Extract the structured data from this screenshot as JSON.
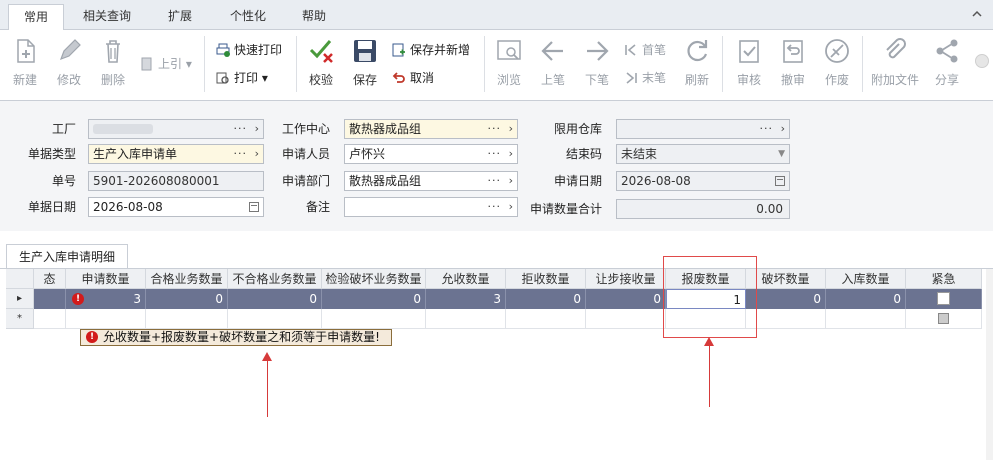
{
  "menu": {
    "tabs": [
      {
        "label": "常用",
        "active": true
      },
      {
        "label": "相关查询"
      },
      {
        "label": "扩展"
      },
      {
        "label": "个性化"
      },
      {
        "label": "帮助"
      }
    ]
  },
  "ribbon": {
    "new": "新建",
    "modify": "修改",
    "delete": "删除",
    "quote": "上引",
    "quick_print": "快速打印",
    "print": "打印",
    "verify": "校验",
    "save": "保存",
    "save_new": "保存并新增",
    "cancel": "取消",
    "browse": "浏览",
    "prev": "上笔",
    "next": "下笔",
    "first": "首笔",
    "last": "末笔",
    "refresh": "刷新",
    "audit": "审核",
    "unaudit": "撤审",
    "void": "作废",
    "attach": "附加文件",
    "share": "分享"
  },
  "form": {
    "factory_label": "工厂",
    "doc_type_label": "单据类型",
    "doc_type_value": "生产入库申请单",
    "doc_no_label": "单号",
    "doc_no_value": "5901-202608080001",
    "doc_date_label": "单据日期",
    "doc_date_value": "2026-08-08",
    "work_center_label": "工作中心",
    "work_center_value": "散热器成品组",
    "applicant_label": "申请人员",
    "applicant_value": "卢怀兴",
    "apply_dept_label": "申请部门",
    "apply_dept_value": "散热器成品组",
    "remark_label": "备注",
    "remark_value": "",
    "limit_wh_label": "限用仓库",
    "limit_wh_value": "",
    "close_code_label": "结束码",
    "close_code_value": "未结束",
    "apply_date_label": "申请日期",
    "apply_date_value": "2026-08-08",
    "apply_total_label": "申请数量合计",
    "apply_total_value": "0.00"
  },
  "detail": {
    "tab_label": "生产入库申请明细",
    "columns": [
      "态",
      "申请数量",
      "合格业务数量",
      "不合格业务数量",
      "检验破坏业务数量",
      "允收数量",
      "拒收数量",
      "让步接收量",
      "报废数量",
      "破坏数量",
      "入库数量",
      "紧急"
    ],
    "row1": [
      "",
      "3",
      "0",
      "0",
      "0",
      "3",
      "0",
      "0",
      "1",
      "0",
      "0",
      ""
    ],
    "new_row_marker": "*",
    "current_row_marker": "▸"
  },
  "error": {
    "message": "允收数量+报废数量+破坏数量之和须等于申请数量!"
  },
  "colors": {
    "accent_red": "#d63a3a",
    "selected_row": "#6b7391",
    "error_bg": "#f4eadb"
  }
}
